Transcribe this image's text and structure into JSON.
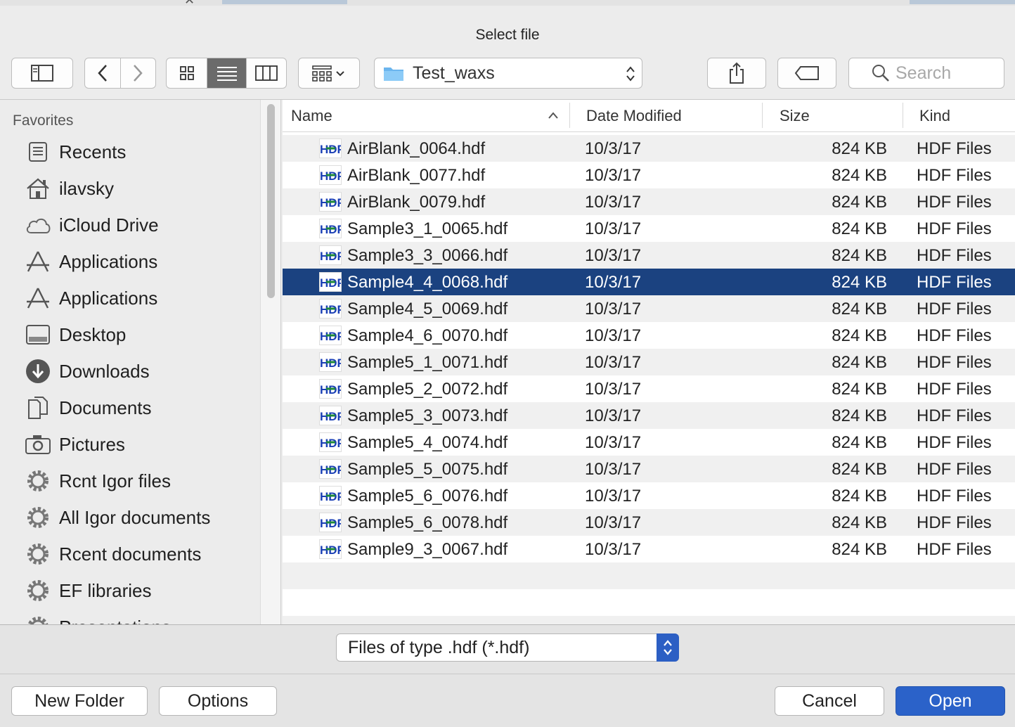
{
  "window": {
    "title": "Select file"
  },
  "toolbar": {
    "path": "Test_waxs",
    "search_placeholder": "Search"
  },
  "sidebar": {
    "header": "Favorites",
    "items": [
      {
        "label": "Recents",
        "icon": "recents-icon"
      },
      {
        "label": "ilavsky",
        "icon": "home-icon"
      },
      {
        "label": "iCloud Drive",
        "icon": "cloud-icon"
      },
      {
        "label": "Applications",
        "icon": "applications-icon"
      },
      {
        "label": "Applications",
        "icon": "applications-icon"
      },
      {
        "label": "Desktop",
        "icon": "desktop-icon"
      },
      {
        "label": "Downloads",
        "icon": "downloads-icon"
      },
      {
        "label": "Documents",
        "icon": "documents-icon"
      },
      {
        "label": "Pictures",
        "icon": "camera-icon"
      },
      {
        "label": "Rcnt Igor files",
        "icon": "gear-icon"
      },
      {
        "label": "All Igor documents",
        "icon": "gear-icon"
      },
      {
        "label": "Rcent documents",
        "icon": "gear-icon"
      },
      {
        "label": "EF libraries",
        "icon": "gear-icon"
      },
      {
        "label": "Presentations",
        "icon": "gear-icon"
      }
    ]
  },
  "columns": {
    "name": "Name",
    "date": "Date Modified",
    "size": "Size",
    "kind": "Kind"
  },
  "files": [
    {
      "name": "AirBlank_0064.hdf",
      "date": "10/3/17",
      "size": "824 KB",
      "kind": "HDF Files"
    },
    {
      "name": "AirBlank_0077.hdf",
      "date": "10/3/17",
      "size": "824 KB",
      "kind": "HDF Files"
    },
    {
      "name": "AirBlank_0079.hdf",
      "date": "10/3/17",
      "size": "824 KB",
      "kind": "HDF Files"
    },
    {
      "name": "Sample3_1_0065.hdf",
      "date": "10/3/17",
      "size": "824 KB",
      "kind": "HDF Files"
    },
    {
      "name": "Sample3_3_0066.hdf",
      "date": "10/3/17",
      "size": "824 KB",
      "kind": "HDF Files"
    },
    {
      "name": "Sample4_4_0068.hdf",
      "date": "10/3/17",
      "size": "824 KB",
      "kind": "HDF Files",
      "selected": true
    },
    {
      "name": "Sample4_5_0069.hdf",
      "date": "10/3/17",
      "size": "824 KB",
      "kind": "HDF Files"
    },
    {
      "name": "Sample4_6_0070.hdf",
      "date": "10/3/17",
      "size": "824 KB",
      "kind": "HDF Files"
    },
    {
      "name": "Sample5_1_0071.hdf",
      "date": "10/3/17",
      "size": "824 KB",
      "kind": "HDF Files"
    },
    {
      "name": "Sample5_2_0072.hdf",
      "date": "10/3/17",
      "size": "824 KB",
      "kind": "HDF Files"
    },
    {
      "name": "Sample5_3_0073.hdf",
      "date": "10/3/17",
      "size": "824 KB",
      "kind": "HDF Files"
    },
    {
      "name": "Sample5_4_0074.hdf",
      "date": "10/3/17",
      "size": "824 KB",
      "kind": "HDF Files"
    },
    {
      "name": "Sample5_5_0075.hdf",
      "date": "10/3/17",
      "size": "824 KB",
      "kind": "HDF Files"
    },
    {
      "name": "Sample5_6_0076.hdf",
      "date": "10/3/17",
      "size": "824 KB",
      "kind": "HDF Files"
    },
    {
      "name": "Sample5_6_0078.hdf",
      "date": "10/3/17",
      "size": "824 KB",
      "kind": "HDF Files"
    },
    {
      "name": "Sample9_3_0067.hdf",
      "date": "10/3/17",
      "size": "824 KB",
      "kind": "HDF Files"
    }
  ],
  "file_icon_text": "HDF",
  "filter": {
    "selected": "Files of type .hdf (*.hdf)"
  },
  "buttons": {
    "new_folder": "New Folder",
    "options": "Options",
    "cancel": "Cancel",
    "open": "Open"
  },
  "colors": {
    "selection": "#1b4280",
    "accent": "#2b62c9",
    "hdf_blue": "#1a3fb5",
    "hdf_green": "#1f8a3a"
  }
}
